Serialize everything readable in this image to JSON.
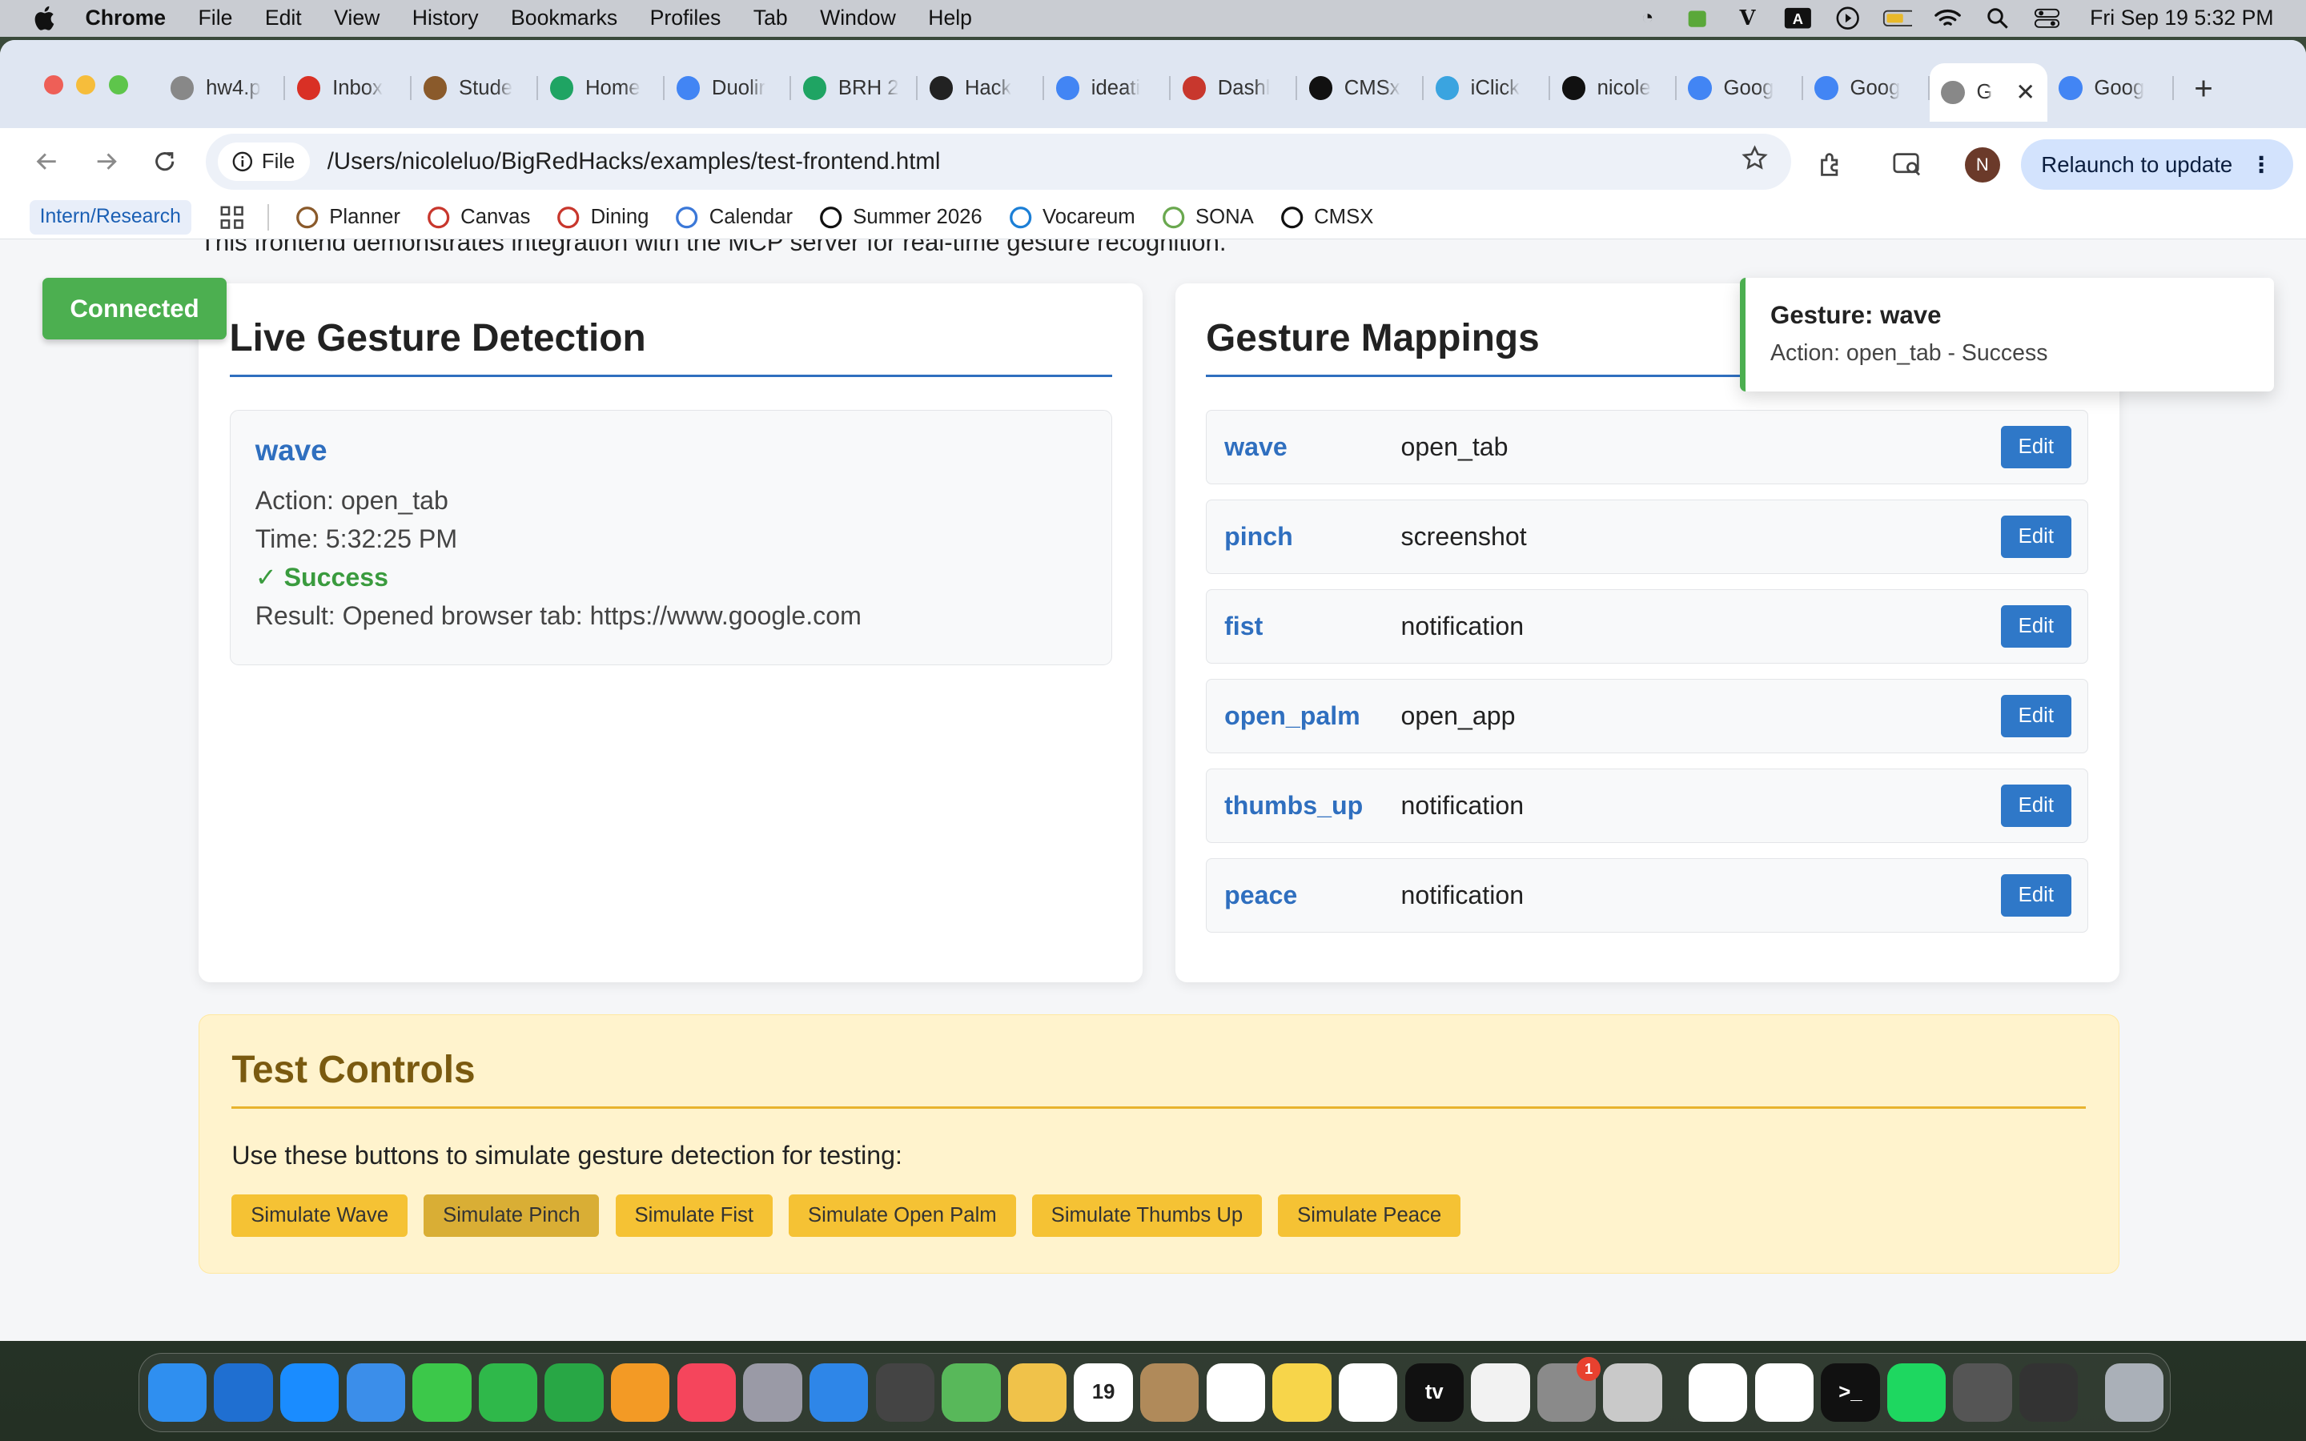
{
  "menubar": {
    "app": "Chrome",
    "items": [
      "File",
      "Edit",
      "View",
      "History",
      "Bookmarks",
      "Profiles",
      "Tab",
      "Window",
      "Help"
    ],
    "datetime": "Fri Sep 19  5:32 PM"
  },
  "tabs": [
    {
      "title": "hw4.p",
      "icon": "globe-icon",
      "color": "#888888"
    },
    {
      "title": "Inbox",
      "icon": "gmail-icon",
      "color": "#d93025"
    },
    {
      "title": "Stude",
      "icon": "books-icon",
      "color": "#8a5a2b"
    },
    {
      "title": "Home",
      "icon": "drive-icon",
      "color": "#1fa463"
    },
    {
      "title": "Duolir",
      "icon": "docs-icon",
      "color": "#4285f4"
    },
    {
      "title": "BRH 2",
      "icon": "drive-icon",
      "color": "#1fa463"
    },
    {
      "title": "Hack",
      "icon": "openai-icon",
      "color": "#222222"
    },
    {
      "title": "ideati",
      "icon": "docs-icon",
      "color": "#4285f4"
    },
    {
      "title": "Dashl",
      "icon": "canvas-icon",
      "color": "#c8372d"
    },
    {
      "title": "CMSx",
      "icon": "cmsx-icon",
      "color": "#111111"
    },
    {
      "title": "iClick",
      "icon": "iclicker-icon",
      "color": "#3aa4e0"
    },
    {
      "title": "nicole",
      "icon": "github-icon",
      "color": "#111111"
    },
    {
      "title": "Goog",
      "icon": "google-icon",
      "color": "#4285f4"
    },
    {
      "title": "Goog",
      "icon": "google-icon",
      "color": "#4285f4"
    },
    {
      "title": "G",
      "icon": "globe-icon",
      "color": "#888888",
      "active": true
    },
    {
      "title": "Goog",
      "icon": "google-icon",
      "color": "#4285f4"
    }
  ],
  "toolbar": {
    "chip_label": "File",
    "url": "/Users/nicoleluo/BigRedHacks/examples/test-frontend.html",
    "avatar_letter": "N",
    "relaunch_label": "Relaunch to update"
  },
  "bookmarks": {
    "first": "Intern/Research",
    "items": [
      {
        "label": "Planner",
        "icon": "books-icon"
      },
      {
        "label": "Canvas",
        "icon": "canvas-icon"
      },
      {
        "label": "Dining",
        "icon": "canvas-icon"
      },
      {
        "label": "Calendar",
        "icon": "calendar-icon"
      },
      {
        "label": "Summer 2026",
        "icon": "github-icon"
      },
      {
        "label": "Vocareum",
        "icon": "vocareum-icon"
      },
      {
        "label": "SONA",
        "icon": "sona-icon"
      },
      {
        "label": "CMSX",
        "icon": "github-icon"
      }
    ]
  },
  "page": {
    "cut_text": "This frontend demonstrates integration with the MCP server for real-time gesture recognition.",
    "status": "Connected",
    "live": {
      "title": "Live Gesture Detection",
      "gesture": "wave",
      "action": "Action: open_tab",
      "time": "Time: 5:32:25 PM",
      "status": "✓ Success",
      "result": "Result: Opened browser tab: https://www.google.com"
    },
    "mappings": {
      "title": "Gesture Mappings",
      "edit_label": "Edit",
      "rows": [
        {
          "gesture": "wave",
          "action": "open_tab"
        },
        {
          "gesture": "pinch",
          "action": "screenshot"
        },
        {
          "gesture": "fist",
          "action": "notification"
        },
        {
          "gesture": "open_palm",
          "action": "open_app"
        },
        {
          "gesture": "thumbs_up",
          "action": "notification"
        },
        {
          "gesture": "peace",
          "action": "notification"
        }
      ]
    },
    "test": {
      "title": "Test Controls",
      "description": "Use these buttons to simulate gesture detection for testing:",
      "buttons": [
        "Simulate Wave",
        "Simulate Pinch",
        "Simulate Fist",
        "Simulate Open Palm",
        "Simulate Thumbs Up",
        "Simulate Peace"
      ]
    },
    "toast": {
      "title": "Gesture: wave",
      "message": "Action: open_tab - Success"
    }
  },
  "dock": [
    {
      "name": "finder",
      "color": "#2f8ff0"
    },
    {
      "name": "keynote",
      "color": "#1f6fd1"
    },
    {
      "name": "app-store",
      "color": "#1a8cff"
    },
    {
      "name": "mail",
      "color": "#3b8eea"
    },
    {
      "name": "messages",
      "color": "#3cc84a"
    },
    {
      "name": "facetime",
      "color": "#2fb84a"
    },
    {
      "name": "numbers",
      "color": "#28a745"
    },
    {
      "name": "pages",
      "color": "#f39a25"
    },
    {
      "name": "music",
      "color": "#f5455c"
    },
    {
      "name": "launchpad",
      "color": "#9a9aa6"
    },
    {
      "name": "safari",
      "color": "#2e86e8"
    },
    {
      "name": "calculator-app",
      "color": "#444444"
    },
    {
      "name": "maps",
      "color": "#58b85a"
    },
    {
      "name": "photos",
      "color": "#f0c24a"
    },
    {
      "name": "calendar",
      "color": "#ffffff",
      "label": "19"
    },
    {
      "name": "contacts",
      "color": "#b08a5a"
    },
    {
      "name": "reminders",
      "color": "#ffffff"
    },
    {
      "name": "notes",
      "color": "#f7d54a"
    },
    {
      "name": "freeform",
      "color": "#ffffff"
    },
    {
      "name": "tv",
      "color": "#111111",
      "label": "tv"
    },
    {
      "name": "news",
      "color": "#f2f2f2"
    },
    {
      "name": "system-settings",
      "color": "#8a8a8a",
      "badge": "1"
    },
    {
      "name": "iphone-mirroring",
      "color": "#c9c9c9"
    },
    {
      "name": "chrome",
      "color": "#ffffff"
    },
    {
      "name": "slack",
      "color": "#ffffff"
    },
    {
      "name": "terminal",
      "color": "#111111",
      "label": ">_"
    },
    {
      "name": "spotify",
      "color": "#1ed760"
    },
    {
      "name": "calculator",
      "color": "#555555"
    },
    {
      "name": "cube-app",
      "color": "#333333"
    },
    {
      "name": "trash",
      "color": "#aab0b8"
    }
  ]
}
